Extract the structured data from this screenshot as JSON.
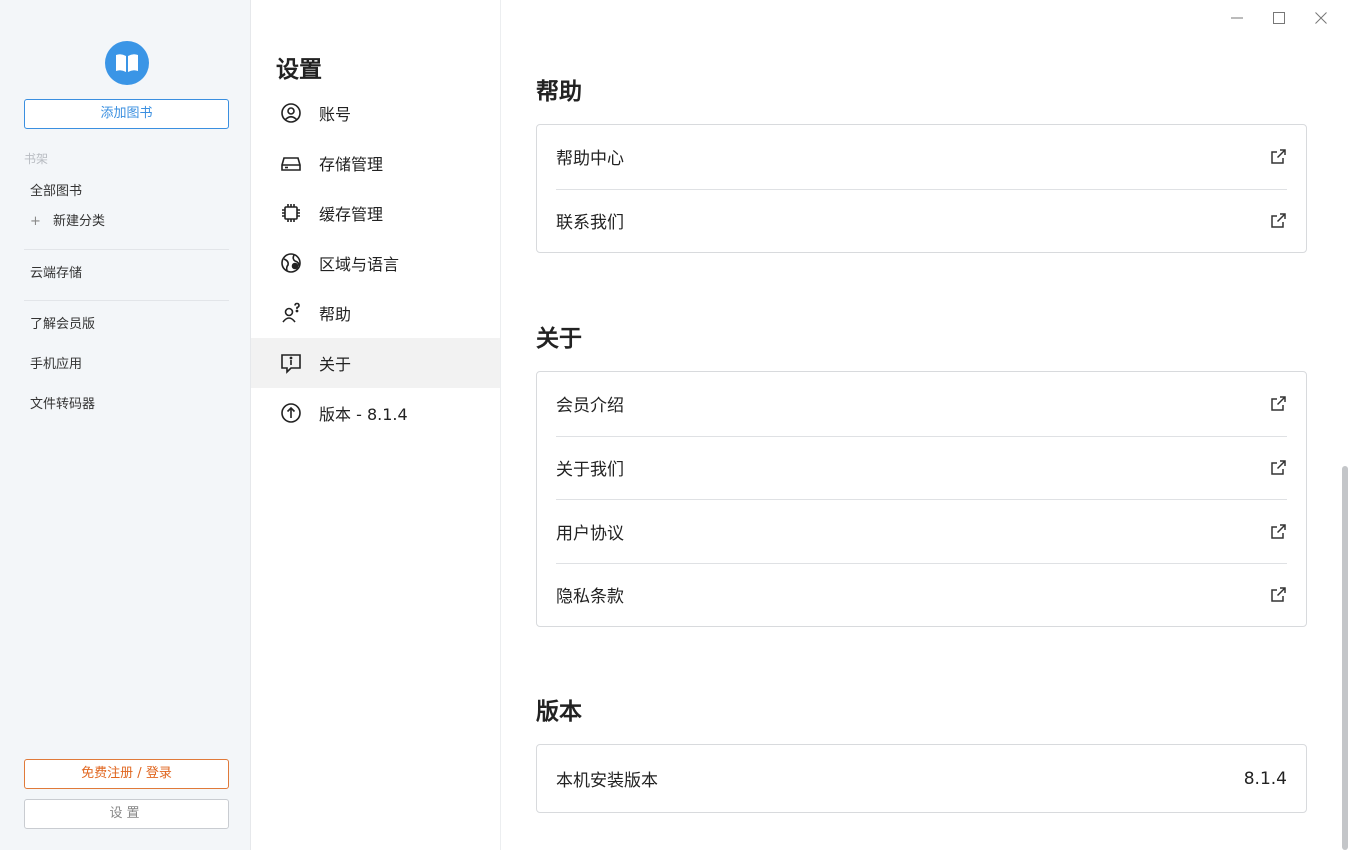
{
  "sidebar": {
    "add_book": "添加图书",
    "bookshelf_label": "书架",
    "all_books": "全部图书",
    "new_category_plus": "+",
    "new_category": "新建分类",
    "cloud_storage": "云端存储",
    "learn_membership": "了解会员版",
    "mobile_app": "手机应用",
    "file_converter": "文件转码器",
    "register_login": "免费注册 / 登录",
    "settings": "设置"
  },
  "settings_nav": {
    "title": "设置",
    "items": [
      {
        "label": "账号",
        "icon": "account-icon"
      },
      {
        "label": "存储管理",
        "icon": "storage-icon"
      },
      {
        "label": "缓存管理",
        "icon": "cache-chip-icon"
      },
      {
        "label": "区域与语言",
        "icon": "globe-icon"
      },
      {
        "label": "帮助",
        "icon": "help-user-icon"
      },
      {
        "label": "关于",
        "icon": "about-info-icon",
        "active": true
      },
      {
        "label": "版本 - 8.1.4",
        "icon": "version-upgrade-icon"
      }
    ]
  },
  "main": {
    "help": {
      "title": "帮助",
      "rows": [
        "帮助中心",
        "联系我们"
      ]
    },
    "about": {
      "title": "关于",
      "rows": [
        "会员介绍",
        "关于我们",
        "用户协议",
        "隐私条款"
      ]
    },
    "version": {
      "title": "版本",
      "label": "本机安装版本",
      "value": "8.1.4"
    }
  },
  "colors": {
    "accent_blue": "#3a8fe0",
    "register_orange": "#e0661f",
    "sidebar_bg": "#f3f6f9"
  }
}
